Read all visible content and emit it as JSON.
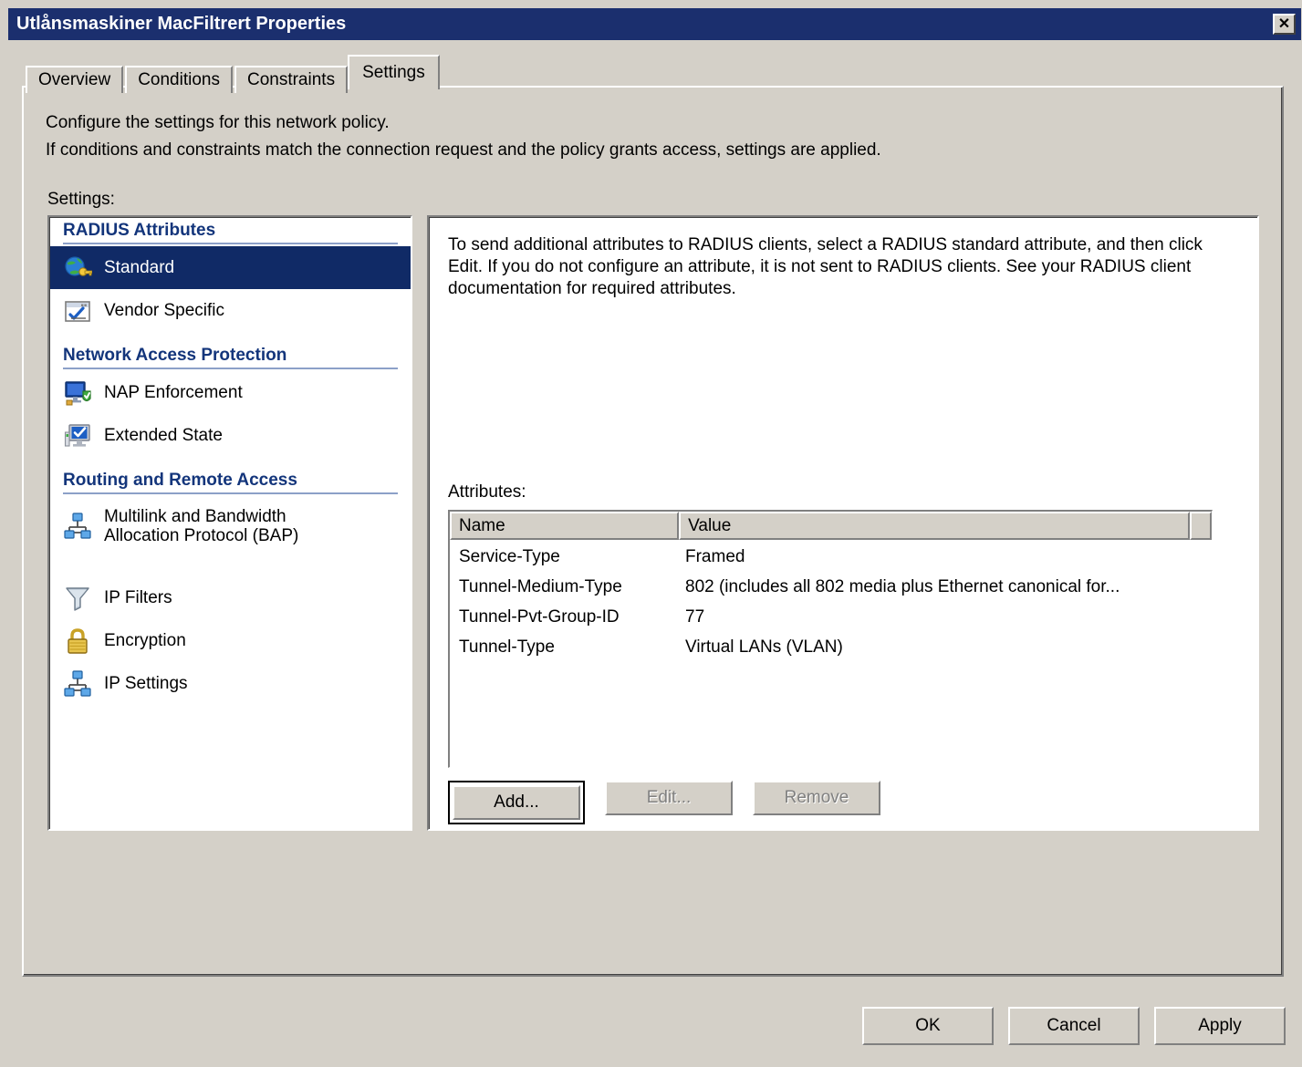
{
  "window": {
    "title": "Utlånsmaskiner MacFiltrert Properties",
    "close_label": "✕",
    "close_icon": "close-icon"
  },
  "tabs": [
    {
      "label": "Overview",
      "active": false
    },
    {
      "label": "Conditions",
      "active": false
    },
    {
      "label": "Constraints",
      "active": false
    },
    {
      "label": "Settings",
      "active": true
    }
  ],
  "page": {
    "description_line1": "Configure the settings for this network policy.",
    "description_line2": "If conditions and constraints match the connection request and the policy grants access, settings are applied.",
    "settings_label": "Settings:"
  },
  "tree": {
    "groups": [
      {
        "header": "RADIUS Attributes",
        "items": [
          {
            "label": "Standard",
            "icon": "globe-key-icon",
            "selected": true
          },
          {
            "label": "Vendor Specific",
            "icon": "window-check-icon",
            "selected": false
          }
        ]
      },
      {
        "header": "Network Access Protection",
        "items": [
          {
            "label": "NAP Enforcement",
            "icon": "monitor-shield-icon",
            "selected": false
          },
          {
            "label": "Extended State",
            "icon": "monitor-check-icon",
            "selected": false
          }
        ]
      },
      {
        "header": "Routing and Remote Access",
        "items": [
          {
            "label": "Multilink and Bandwidth\nAllocation Protocol (BAP)",
            "label_line1": "Multilink and Bandwidth",
            "label_line2": "Allocation Protocol (BAP)",
            "icon": "network-nodes-icon",
            "selected": false
          },
          {
            "label": "IP Filters",
            "icon": "funnel-icon",
            "selected": false
          },
          {
            "label": "Encryption",
            "icon": "padlock-icon",
            "selected": false
          },
          {
            "label": "IP Settings",
            "icon": "network-nodes-icon",
            "selected": false
          }
        ]
      }
    ]
  },
  "details": {
    "description": "To send additional attributes to RADIUS clients, select a RADIUS standard attribute, and then click Edit. If you do not configure an attribute, it is not sent to RADIUS clients. See your RADIUS client documentation for required attributes.",
    "attributes_label": "Attributes:",
    "table": {
      "columns": [
        "Name",
        "Value",
        ""
      ],
      "rows": [
        {
          "name": "Service-Type",
          "value": "Framed"
        },
        {
          "name": "Tunnel-Medium-Type",
          "value": "802 (includes all 802 media plus Ethernet canonical for..."
        },
        {
          "name": "Tunnel-Pvt-Group-ID",
          "value": "77"
        },
        {
          "name": "Tunnel-Type",
          "value": "Virtual LANs (VLAN)"
        }
      ]
    },
    "buttons": [
      {
        "label": "Add...",
        "enabled": true,
        "focused": true
      },
      {
        "label": "Edit...",
        "enabled": false,
        "focused": false
      },
      {
        "label": "Remove",
        "enabled": false,
        "focused": false
      }
    ]
  },
  "dialog_buttons": [
    {
      "label": "OK",
      "enabled": true
    },
    {
      "label": "Cancel",
      "enabled": true
    },
    {
      "label": "Apply",
      "enabled": true
    }
  ],
  "colors": {
    "titlebar": "#1b2f6e",
    "face": "#d4d0c8",
    "selection": "#102a66",
    "group_header": "#13357b"
  }
}
